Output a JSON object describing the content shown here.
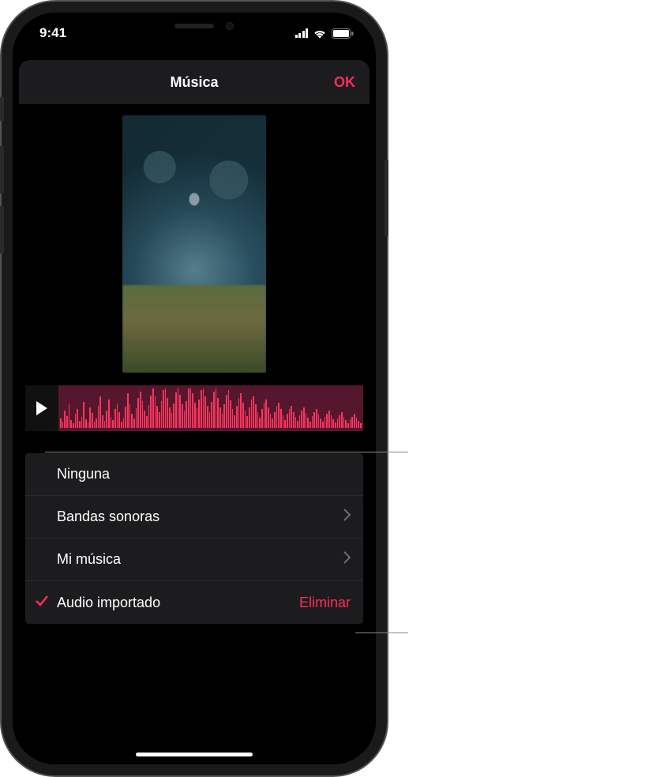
{
  "status": {
    "time": "9:41",
    "signal_icon": "cellular-signal-icon",
    "wifi_icon": "wifi-icon",
    "battery_icon": "battery-icon"
  },
  "nav": {
    "title": "Música",
    "done_label": "OK"
  },
  "accent_color": "#ff2d55",
  "preview": {
    "description": "Underwater aquarium video thumbnail"
  },
  "audio": {
    "play_icon": "play-icon",
    "waveform_bars": [
      12,
      8,
      22,
      15,
      30,
      10,
      6,
      18,
      24,
      9,
      14,
      33,
      11,
      7,
      26,
      19,
      8,
      12,
      28,
      40,
      16,
      9,
      22,
      36,
      14,
      10,
      24,
      31,
      20,
      8,
      13,
      27,
      44,
      30,
      18,
      12,
      25,
      38,
      46,
      34,
      22,
      15,
      29,
      41,
      50,
      40,
      28,
      20,
      34,
      48,
      52,
      38,
      26,
      19,
      31,
      45,
      55,
      42,
      30,
      22,
      34,
      50,
      56,
      44,
      32,
      25,
      36,
      48,
      54,
      40,
      28,
      20,
      33,
      46,
      52,
      38,
      26,
      18,
      30,
      42,
      48,
      35,
      24,
      16,
      28,
      38,
      44,
      32,
      22,
      15,
      26,
      36,
      40,
      30,
      20,
      13,
      24,
      32,
      36,
      26,
      18,
      12,
      20,
      28,
      32,
      24,
      16,
      10,
      18,
      24,
      28,
      20,
      14,
      9,
      16,
      22,
      26,
      19,
      13,
      8,
      15,
      20,
      24,
      18,
      12,
      8,
      14,
      18,
      22,
      16,
      11,
      7,
      12,
      16,
      20,
      14,
      10,
      6,
      11,
      14,
      18,
      13,
      9,
      6
    ]
  },
  "options": {
    "none_label": "Ninguna",
    "soundtracks_label": "Bandas sonoras",
    "my_music_label": "Mi música",
    "imported_label": "Audio importado",
    "delete_label": "Eliminar",
    "selected": "imported"
  }
}
